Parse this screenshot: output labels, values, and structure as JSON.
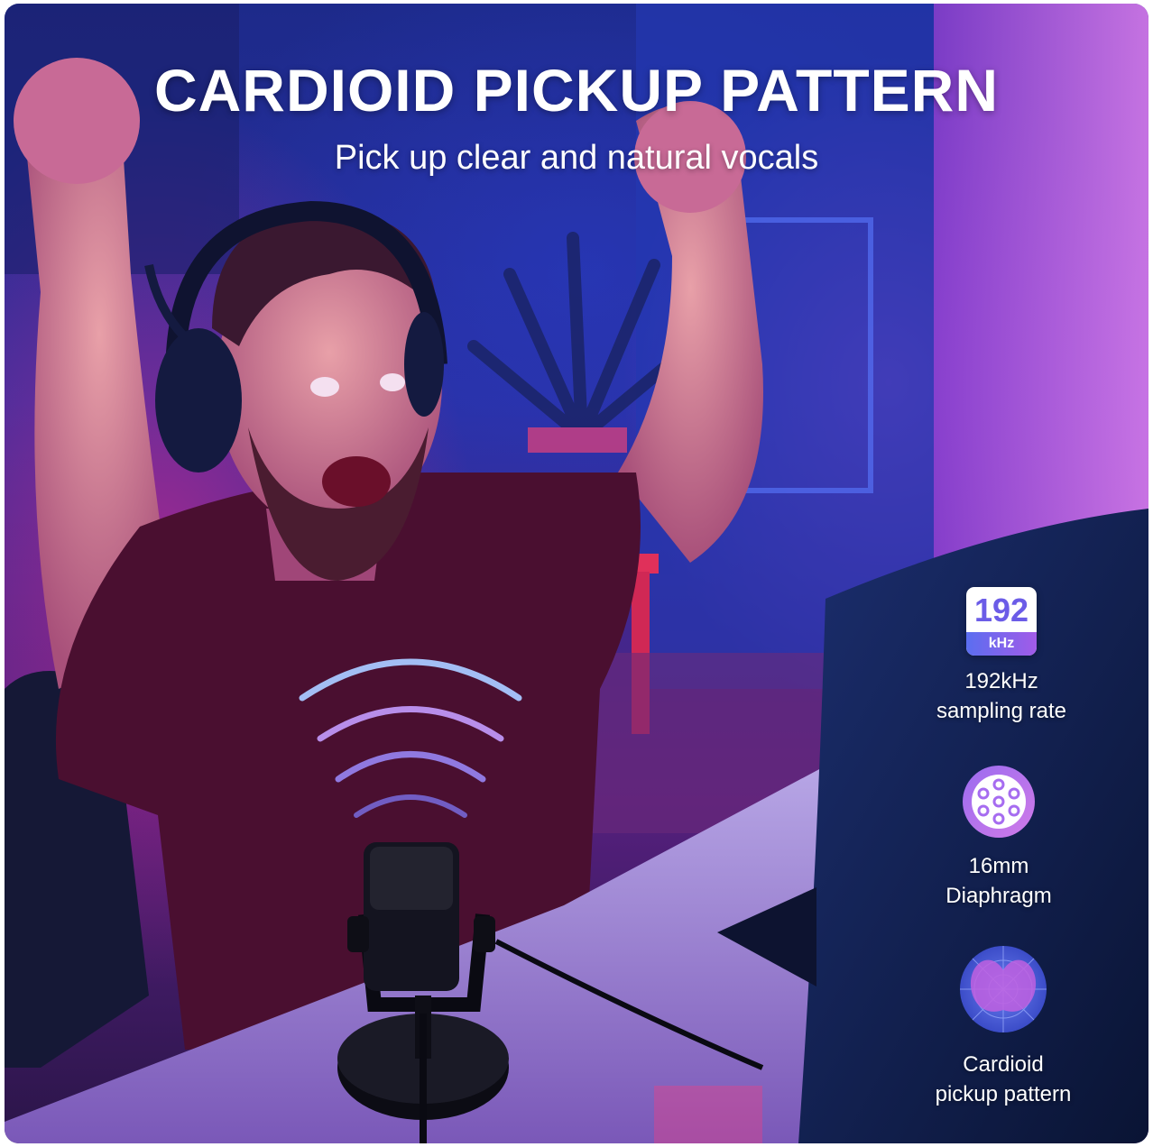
{
  "headline": "CARDIOID PICKUP PATTERN",
  "subheadline": "Pick up clear and natural vocals",
  "features": [
    {
      "icon": "sample-rate-192khz-icon",
      "icon_value": "192",
      "icon_unit": "kHz",
      "line1": "192kHz",
      "line2": "sampling rate"
    },
    {
      "icon": "diaphragm-icon",
      "line1": "16mm",
      "line2": "Diaphragm"
    },
    {
      "icon": "cardioid-polar-pattern-icon",
      "line1": "Cardioid",
      "line2": "pickup pattern"
    }
  ],
  "colors": {
    "accent_purple": "#a25be8",
    "accent_blue": "#5b6ef0",
    "text": "#ffffff"
  }
}
